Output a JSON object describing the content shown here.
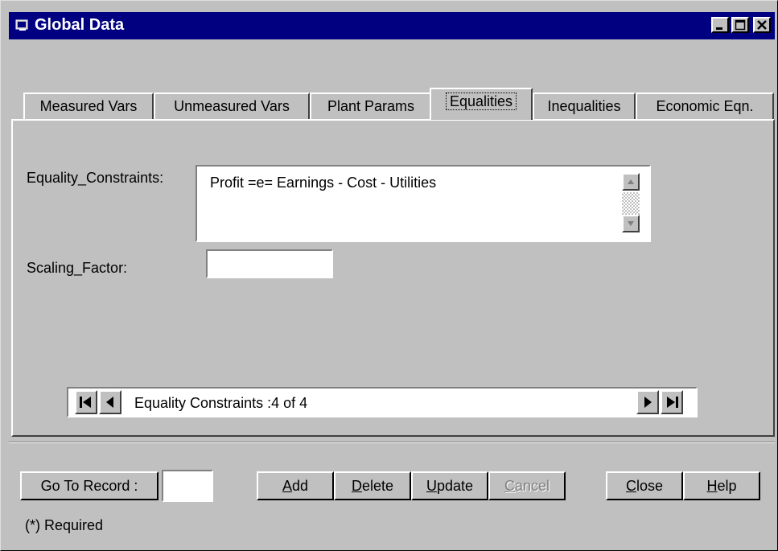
{
  "window": {
    "title": "Global Data"
  },
  "tabs": [
    {
      "label": "Measured Vars",
      "active": false
    },
    {
      "label": "Unmeasured Vars",
      "active": false
    },
    {
      "label": "Plant Params",
      "active": false
    },
    {
      "label": "Equalities",
      "active": true
    },
    {
      "label": "Inequalities",
      "active": false
    },
    {
      "label": "Economic Eqn.",
      "active": false
    }
  ],
  "form": {
    "equality_label": "Equality_Constraints:",
    "equality_value": "Profit =e= Earnings - Cost - Utilities",
    "scaling_label": "Scaling_Factor:",
    "scaling_value": ""
  },
  "navigator": {
    "text": "Equality Constraints :4 of 4"
  },
  "footer": {
    "goto_label": "Go To Record :",
    "goto_value": "",
    "add_rest": "dd",
    "add_key": "A",
    "delete_key": "D",
    "delete_rest": "elete",
    "update_key": "U",
    "update_rest": "pdate",
    "cancel_key": "C",
    "cancel_rest": "ancel",
    "close_key": "C",
    "close_rest": "lose",
    "help_key": "H",
    "help_rest": "elp",
    "required_note": "(*)  Required"
  }
}
